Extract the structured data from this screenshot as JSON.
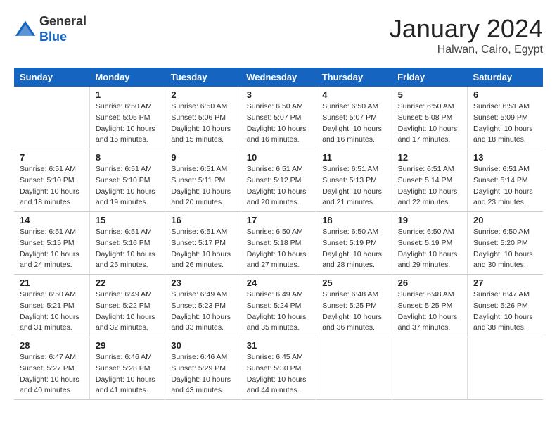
{
  "header": {
    "logo_general": "General",
    "logo_blue": "Blue",
    "month_title": "January 2024",
    "location": "Halwan, Cairo, Egypt"
  },
  "days_of_week": [
    "Sunday",
    "Monday",
    "Tuesday",
    "Wednesday",
    "Thursday",
    "Friday",
    "Saturday"
  ],
  "weeks": [
    [
      {
        "day": "",
        "sunrise": "",
        "sunset": "",
        "daylight": ""
      },
      {
        "day": "1",
        "sunrise": "6:50 AM",
        "sunset": "5:05 PM",
        "daylight": "10 hours and 15 minutes."
      },
      {
        "day": "2",
        "sunrise": "6:50 AM",
        "sunset": "5:06 PM",
        "daylight": "10 hours and 15 minutes."
      },
      {
        "day": "3",
        "sunrise": "6:50 AM",
        "sunset": "5:07 PM",
        "daylight": "10 hours and 16 minutes."
      },
      {
        "day": "4",
        "sunrise": "6:50 AM",
        "sunset": "5:07 PM",
        "daylight": "10 hours and 16 minutes."
      },
      {
        "day": "5",
        "sunrise": "6:50 AM",
        "sunset": "5:08 PM",
        "daylight": "10 hours and 17 minutes."
      },
      {
        "day": "6",
        "sunrise": "6:51 AM",
        "sunset": "5:09 PM",
        "daylight": "10 hours and 18 minutes."
      }
    ],
    [
      {
        "day": "7",
        "sunrise": "6:51 AM",
        "sunset": "5:10 PM",
        "daylight": "10 hours and 18 minutes."
      },
      {
        "day": "8",
        "sunrise": "6:51 AM",
        "sunset": "5:10 PM",
        "daylight": "10 hours and 19 minutes."
      },
      {
        "day": "9",
        "sunrise": "6:51 AM",
        "sunset": "5:11 PM",
        "daylight": "10 hours and 20 minutes."
      },
      {
        "day": "10",
        "sunrise": "6:51 AM",
        "sunset": "5:12 PM",
        "daylight": "10 hours and 20 minutes."
      },
      {
        "day": "11",
        "sunrise": "6:51 AM",
        "sunset": "5:13 PM",
        "daylight": "10 hours and 21 minutes."
      },
      {
        "day": "12",
        "sunrise": "6:51 AM",
        "sunset": "5:14 PM",
        "daylight": "10 hours and 22 minutes."
      },
      {
        "day": "13",
        "sunrise": "6:51 AM",
        "sunset": "5:14 PM",
        "daylight": "10 hours and 23 minutes."
      }
    ],
    [
      {
        "day": "14",
        "sunrise": "6:51 AM",
        "sunset": "5:15 PM",
        "daylight": "10 hours and 24 minutes."
      },
      {
        "day": "15",
        "sunrise": "6:51 AM",
        "sunset": "5:16 PM",
        "daylight": "10 hours and 25 minutes."
      },
      {
        "day": "16",
        "sunrise": "6:51 AM",
        "sunset": "5:17 PM",
        "daylight": "10 hours and 26 minutes."
      },
      {
        "day": "17",
        "sunrise": "6:50 AM",
        "sunset": "5:18 PM",
        "daylight": "10 hours and 27 minutes."
      },
      {
        "day": "18",
        "sunrise": "6:50 AM",
        "sunset": "5:19 PM",
        "daylight": "10 hours and 28 minutes."
      },
      {
        "day": "19",
        "sunrise": "6:50 AM",
        "sunset": "5:19 PM",
        "daylight": "10 hours and 29 minutes."
      },
      {
        "day": "20",
        "sunrise": "6:50 AM",
        "sunset": "5:20 PM",
        "daylight": "10 hours and 30 minutes."
      }
    ],
    [
      {
        "day": "21",
        "sunrise": "6:50 AM",
        "sunset": "5:21 PM",
        "daylight": "10 hours and 31 minutes."
      },
      {
        "day": "22",
        "sunrise": "6:49 AM",
        "sunset": "5:22 PM",
        "daylight": "10 hours and 32 minutes."
      },
      {
        "day": "23",
        "sunrise": "6:49 AM",
        "sunset": "5:23 PM",
        "daylight": "10 hours and 33 minutes."
      },
      {
        "day": "24",
        "sunrise": "6:49 AM",
        "sunset": "5:24 PM",
        "daylight": "10 hours and 35 minutes."
      },
      {
        "day": "25",
        "sunrise": "6:48 AM",
        "sunset": "5:25 PM",
        "daylight": "10 hours and 36 minutes."
      },
      {
        "day": "26",
        "sunrise": "6:48 AM",
        "sunset": "5:25 PM",
        "daylight": "10 hours and 37 minutes."
      },
      {
        "day": "27",
        "sunrise": "6:47 AM",
        "sunset": "5:26 PM",
        "daylight": "10 hours and 38 minutes."
      }
    ],
    [
      {
        "day": "28",
        "sunrise": "6:47 AM",
        "sunset": "5:27 PM",
        "daylight": "10 hours and 40 minutes."
      },
      {
        "day": "29",
        "sunrise": "6:46 AM",
        "sunset": "5:28 PM",
        "daylight": "10 hours and 41 minutes."
      },
      {
        "day": "30",
        "sunrise": "6:46 AM",
        "sunset": "5:29 PM",
        "daylight": "10 hours and 43 minutes."
      },
      {
        "day": "31",
        "sunrise": "6:45 AM",
        "sunset": "5:30 PM",
        "daylight": "10 hours and 44 minutes."
      },
      {
        "day": "",
        "sunrise": "",
        "sunset": "",
        "daylight": ""
      },
      {
        "day": "",
        "sunrise": "",
        "sunset": "",
        "daylight": ""
      },
      {
        "day": "",
        "sunrise": "",
        "sunset": "",
        "daylight": ""
      }
    ]
  ],
  "labels": {
    "sunrise": "Sunrise:",
    "sunset": "Sunset:",
    "daylight": "Daylight:"
  }
}
